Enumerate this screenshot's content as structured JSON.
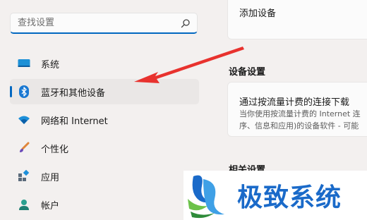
{
  "search": {
    "placeholder": "查找设置"
  },
  "nav": {
    "items": [
      {
        "label": "系统",
        "icon": "system-icon"
      },
      {
        "label": "蓝牙和其他设备",
        "icon": "bluetooth-icon",
        "selected": true
      },
      {
        "label": "网络和 Internet",
        "icon": "wifi-icon"
      },
      {
        "label": "个性化",
        "icon": "brush-icon"
      },
      {
        "label": "应用",
        "icon": "apps-icon"
      },
      {
        "label": "帐户",
        "icon": "account-icon"
      }
    ]
  },
  "content": {
    "add_device": {
      "label": "添加设备"
    },
    "device_settings": {
      "title": "设备设置",
      "metered": {
        "label": "通过按流量计费的连接下载",
        "desc_line1": "当你使用按流量计费的 Internet 连",
        "desc_line2": "序、信息和应用)的设备软件 - 可能"
      }
    },
    "related": {
      "title": "相关设置"
    }
  },
  "watermark": {
    "text": "极致系统"
  },
  "colors": {
    "accent": "#0067c0",
    "arrow": "#e8322e",
    "watermark": "#1a6ac9"
  }
}
